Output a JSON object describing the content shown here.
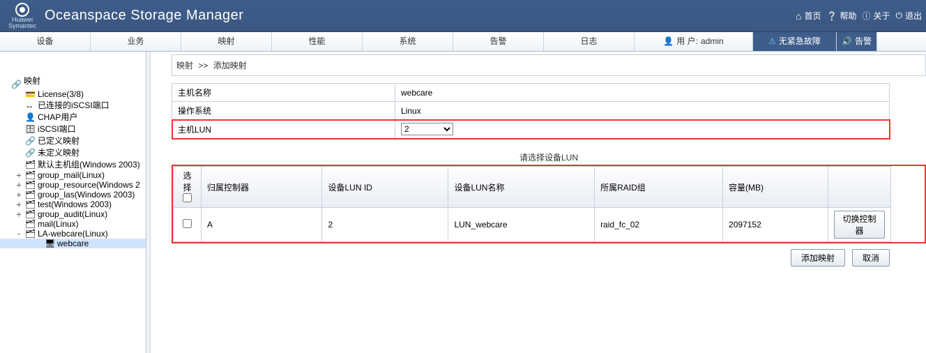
{
  "header": {
    "logo_line1": "Huawei",
    "logo_line2": "Symantec",
    "app_title": "Oceanspace Storage Manager",
    "links": {
      "home": "首页",
      "help": "帮助",
      "about": "关于",
      "exit": "退出"
    }
  },
  "menubar": {
    "tabs": [
      "设备",
      "业务",
      "映射",
      "性能",
      "系统",
      "告警",
      "日志"
    ],
    "user_prefix": "用 户:",
    "user_name": "admin",
    "no_alert": "无紧急故障",
    "alarm_tab": "告警"
  },
  "sidebar": {
    "root": "映射",
    "items": [
      {
        "label": "License(3/8)",
        "icon": "card",
        "exp": ""
      },
      {
        "label": "已连接的iSCSI端口",
        "icon": "port",
        "exp": ""
      },
      {
        "label": "CHAP用户",
        "icon": "user",
        "exp": ""
      },
      {
        "label": "iSCSI端口",
        "icon": "port2",
        "exp": ""
      },
      {
        "label": "已定义映射",
        "icon": "link",
        "exp": ""
      },
      {
        "label": "未定义映射",
        "icon": "link",
        "exp": ""
      },
      {
        "label": "默认主机组(Windows 2003)",
        "icon": "hostgrp",
        "exp": ""
      },
      {
        "label": "group_mail(Linux)",
        "icon": "hostgrp",
        "exp": "+"
      },
      {
        "label": "group_resource(Windows 2",
        "icon": "hostgrp",
        "exp": "+"
      },
      {
        "label": "group_las(Windows 2003)",
        "icon": "hostgrp",
        "exp": "+"
      },
      {
        "label": "test(Windows 2003)",
        "icon": "hostgrp",
        "exp": "+"
      },
      {
        "label": "group_audit(Linux)",
        "icon": "hostgrp",
        "exp": "+"
      },
      {
        "label": "mail(Linux)",
        "icon": "hostgrp",
        "exp": ""
      },
      {
        "label": "LA-webcare(Linux)",
        "icon": "hostgrp",
        "exp": "-"
      },
      {
        "label": "webcare",
        "icon": "host",
        "exp": "",
        "child": true,
        "selected": true
      }
    ]
  },
  "breadcrumb": {
    "a": "映射",
    "sep": ">>",
    "b": "添加映射"
  },
  "host_form": {
    "rows": [
      {
        "label": "主机名称",
        "value": "webcare"
      },
      {
        "label": "操作系统",
        "value": "Linux"
      }
    ],
    "lun_label": "主机LUN",
    "lun_value": "2"
  },
  "lun_section_title": "请选择设备LUN",
  "lun_table": {
    "headers": {
      "sel": "选择",
      "ctrl": "归属控制器",
      "devid": "设备LUN ID",
      "devname": "设备LUN名称",
      "raid": "所属RAID组",
      "cap": "容量(MB)",
      "switch_btn": "切换控制器"
    },
    "rows": [
      {
        "ctrl": "A",
        "devid": "2",
        "devname": "LUN_webcare",
        "raid": "raid_fc_02",
        "cap": "2097152"
      }
    ]
  },
  "actions": {
    "add": "添加映射",
    "cancel": "取消"
  }
}
